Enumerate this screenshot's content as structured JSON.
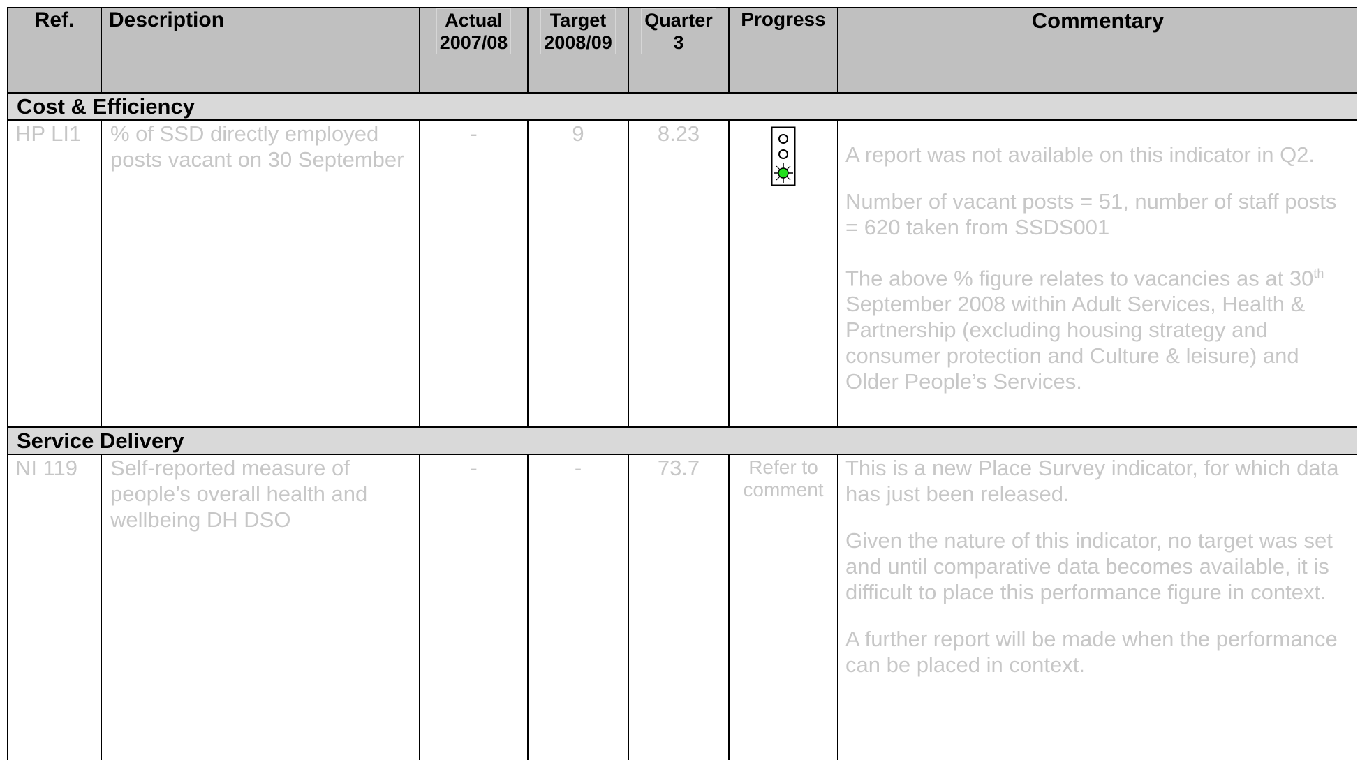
{
  "headers": {
    "ref": "Ref.",
    "description": "Description",
    "actual_line1": "Actual",
    "actual_line2": "2007/08",
    "target_line1": "Target",
    "target_line2": "2008/09",
    "quarter_line1": "Quarter",
    "quarter_line2": "3",
    "progress": "Progress",
    "commentary": "Commentary"
  },
  "sections": [
    {
      "title": "Cost & Efficiency",
      "row": {
        "ref": "HP LI1",
        "description": "% of SSD directly employed posts vacant on 30 September",
        "actual": "-",
        "target": "9",
        "quarter": "8.23",
        "progress_icon": "traffic-light-green-icon",
        "commentary": [
          "A report was not available on this indicator in Q2.",
          "Number of vacant posts = 51, number of staff posts = 620 taken from SSDS001",
          "The above % figure relates to vacancies as at 30",
          "th",
          "September 2008 within Adult Services, Health & Partnership (excluding housing strategy and consumer protection and Culture & leisure) and Older People’s Services."
        ]
      }
    },
    {
      "title": "Service Delivery",
      "row": {
        "ref": "NI 119",
        "description": "Self-reported measure of people’s overall health and wellbeing DH DSO",
        "actual": "-",
        "target": "-",
        "quarter": "73.7",
        "progress_text_line1": "Refer to",
        "progress_text_line2": "comment",
        "commentary": [
          "This is a new Place Survey indicator, for which data has just been released.",
          "Given the nature of this indicator, no target was set and until comparative data becomes available, it is difficult to place this performance figure in context.",
          "A further report will be made when the performance can be placed in context."
        ]
      }
    }
  ],
  "colors": {
    "header_bg": "#c0c0c0",
    "section_bg": "#d9d9d9",
    "faded_text": "#c7c7c7",
    "light_on": "#22e01c"
  }
}
